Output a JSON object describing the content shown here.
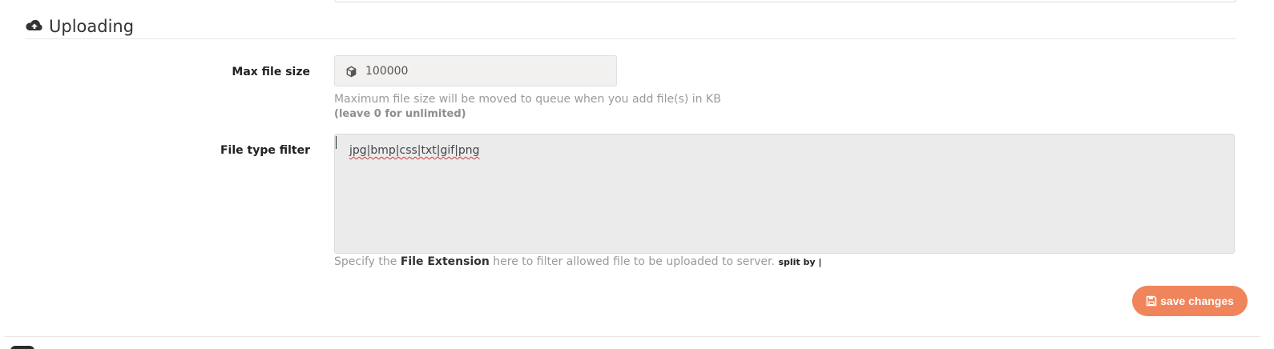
{
  "section": {
    "title": "Uploading",
    "icon": "cloud-upload-icon"
  },
  "max_file_size": {
    "label": "Max file size",
    "value": "100000",
    "icon": "cube-icon",
    "help": "Maximum file size will be moved to queue when you add file(s) in KB",
    "help_note": "(leave 0 for unlimited)"
  },
  "file_type_filter": {
    "label": "File type filter",
    "value": "jpg|bmp|css|txt|gif|png",
    "help_prefix": "Specify the",
    "help_strong": "File Extension",
    "help_suffix": "here to filter allowed file to be uploaded to server.",
    "help_small": "split by |"
  },
  "actions": {
    "save_label": "save changes",
    "save_icon": "floppy-disk-icon",
    "save_color": "#f0845a"
  }
}
